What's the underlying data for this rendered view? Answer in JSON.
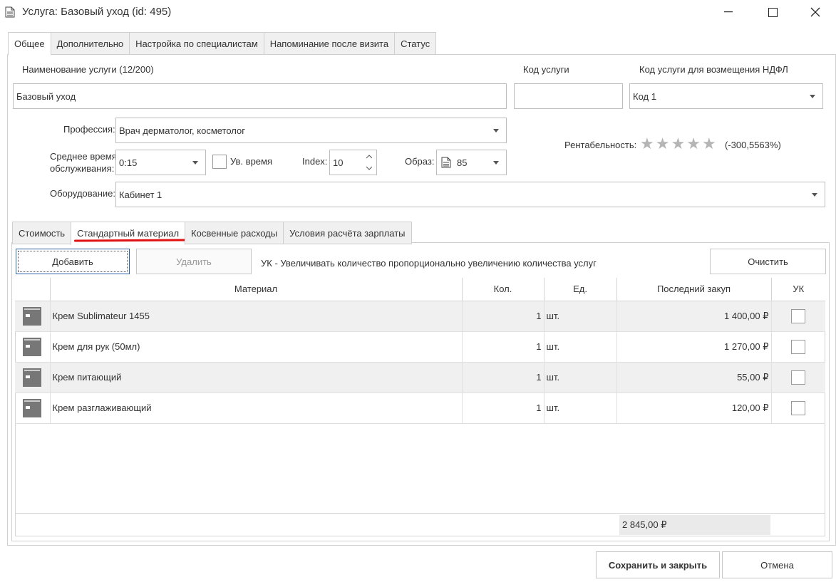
{
  "window": {
    "title": "Услуга: Базовый уход (id: 495)",
    "minimize_label": "—",
    "maximize_label": "☐",
    "close_label": "✕"
  },
  "tabs": [
    {
      "label": "Общее",
      "active": true
    },
    {
      "label": "Дополнительно"
    },
    {
      "label": "Настройка по специалистам"
    },
    {
      "label": "Напоминание после визита"
    },
    {
      "label": "Статус"
    }
  ],
  "form": {
    "service_name_label": "Наименование услуги (12/200)",
    "service_name_value": "Базовый уход",
    "service_code_label": "Код услуги",
    "service_code_value": "",
    "ndfl_code_label": "Код услуги для возмещения НДФЛ",
    "ndfl_code_value": "Код 1",
    "profession_label": "Профессия:",
    "profession_value": "Врач дерматолог, косметолог",
    "avg_time_label_1": "Среднее время",
    "avg_time_label_2": "обслуживания:",
    "avg_time_value": "0:15",
    "inc_time_label": "Ув. время",
    "index_label": "Index:",
    "index_value": "10",
    "image_label": "Образ:",
    "image_value": "85",
    "equipment_label": "Оборудование:",
    "equipment_value": "Кабинет 1",
    "profitability_label": "Рентабельность:",
    "profitability_value": "(-300,5563%)",
    "stars_filled": 0,
    "stars_total": 5
  },
  "inner_tabs": [
    {
      "label": "Стоимость"
    },
    {
      "label": "Стандартный материал",
      "active": true
    },
    {
      "label": "Косвенные расходы"
    },
    {
      "label": "Условия расчёта зарплаты"
    }
  ],
  "toolbar": {
    "add_label": "Добавить",
    "delete_label": "Удалить",
    "hint": "УК - Увеличивать количество пропорционально увеличению количества услуг",
    "clear_label": "Очистить"
  },
  "table": {
    "columns": [
      "",
      "Материал",
      "Кол.",
      "Ед.",
      "Последний закуп",
      "УК"
    ],
    "rows": [
      {
        "name": "Крем Sublimateur 1455",
        "qty": "1",
        "unit": "шт.",
        "last": "1 400,00 ₽"
      },
      {
        "name": "Крем для рук (50мл)",
        "qty": "1",
        "unit": "шт.",
        "last": "1 270,00 ₽"
      },
      {
        "name": "Крем питающий",
        "qty": "1",
        "unit": "шт.",
        "last": "55,00 ₽"
      },
      {
        "name": "Крем разглаживающий",
        "qty": "1",
        "unit": "шт.",
        "last": "120,00 ₽"
      }
    ],
    "total": "2 845,00 ₽"
  },
  "footer": {
    "save_label": "Сохранить и закрыть",
    "cancel_label": "Отмена"
  }
}
